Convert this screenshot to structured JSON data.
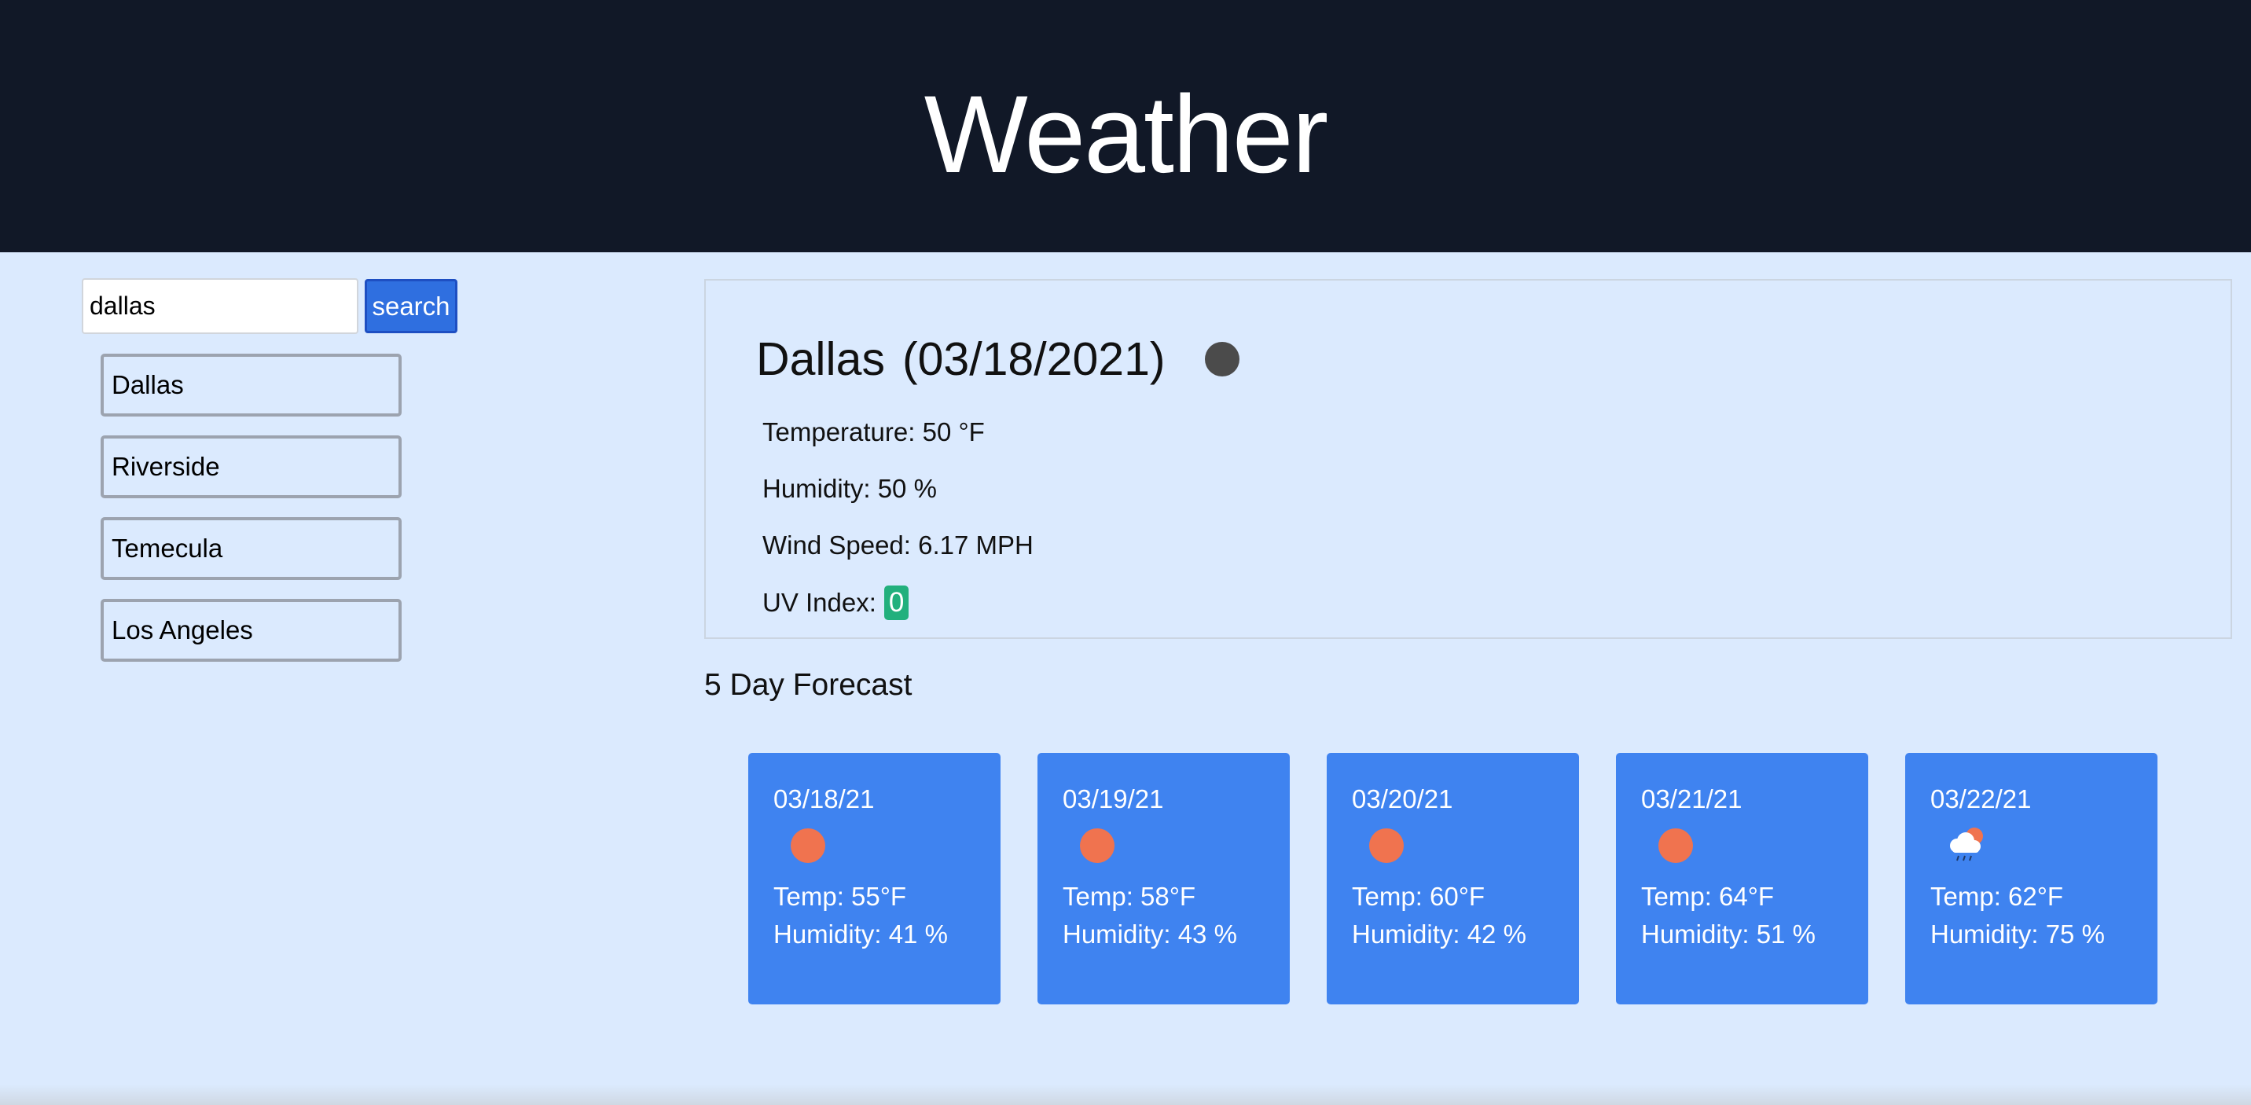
{
  "header": {
    "title": "Weather"
  },
  "search": {
    "value": "dallas",
    "button_label": "search"
  },
  "history": [
    "Dallas",
    "Riverside",
    "Temecula",
    "Los Angeles"
  ],
  "current": {
    "city": "Dallas",
    "date": "(03/18/2021)",
    "icon": "dark-circle-weather-icon",
    "temperature": "Temperature: 50 °F",
    "humidity": "Humidity: 50 %",
    "wind": "Wind Speed: 6.17 MPH",
    "uv_label": "UV Index:",
    "uv_value": "0",
    "uv_color": "#22b07d"
  },
  "forecast": {
    "title": "5 Day Forecast",
    "days": [
      {
        "date": "03/18/21",
        "icon": "sun-icon",
        "temp": "Temp: 55°F",
        "humidity": "Humidity: 41 %"
      },
      {
        "date": "03/19/21",
        "icon": "sun-icon",
        "temp": "Temp: 58°F",
        "humidity": "Humidity: 43 %"
      },
      {
        "date": "03/20/21",
        "icon": "sun-icon",
        "temp": "Temp: 60°F",
        "humidity": "Humidity: 42 %"
      },
      {
        "date": "03/21/21",
        "icon": "sun-icon",
        "temp": "Temp: 64°F",
        "humidity": "Humidity: 51 %"
      },
      {
        "date": "03/22/21",
        "icon": "rain-cloud-icon",
        "temp": "Temp: 62°F",
        "humidity": "Humidity: 75 %"
      }
    ]
  },
  "colors": {
    "header_bg": "#111827",
    "page_bg": "#dbeafe",
    "card_bg": "#3f83f0",
    "button_bg": "#2f6fe0",
    "sun": "#f0734f"
  }
}
